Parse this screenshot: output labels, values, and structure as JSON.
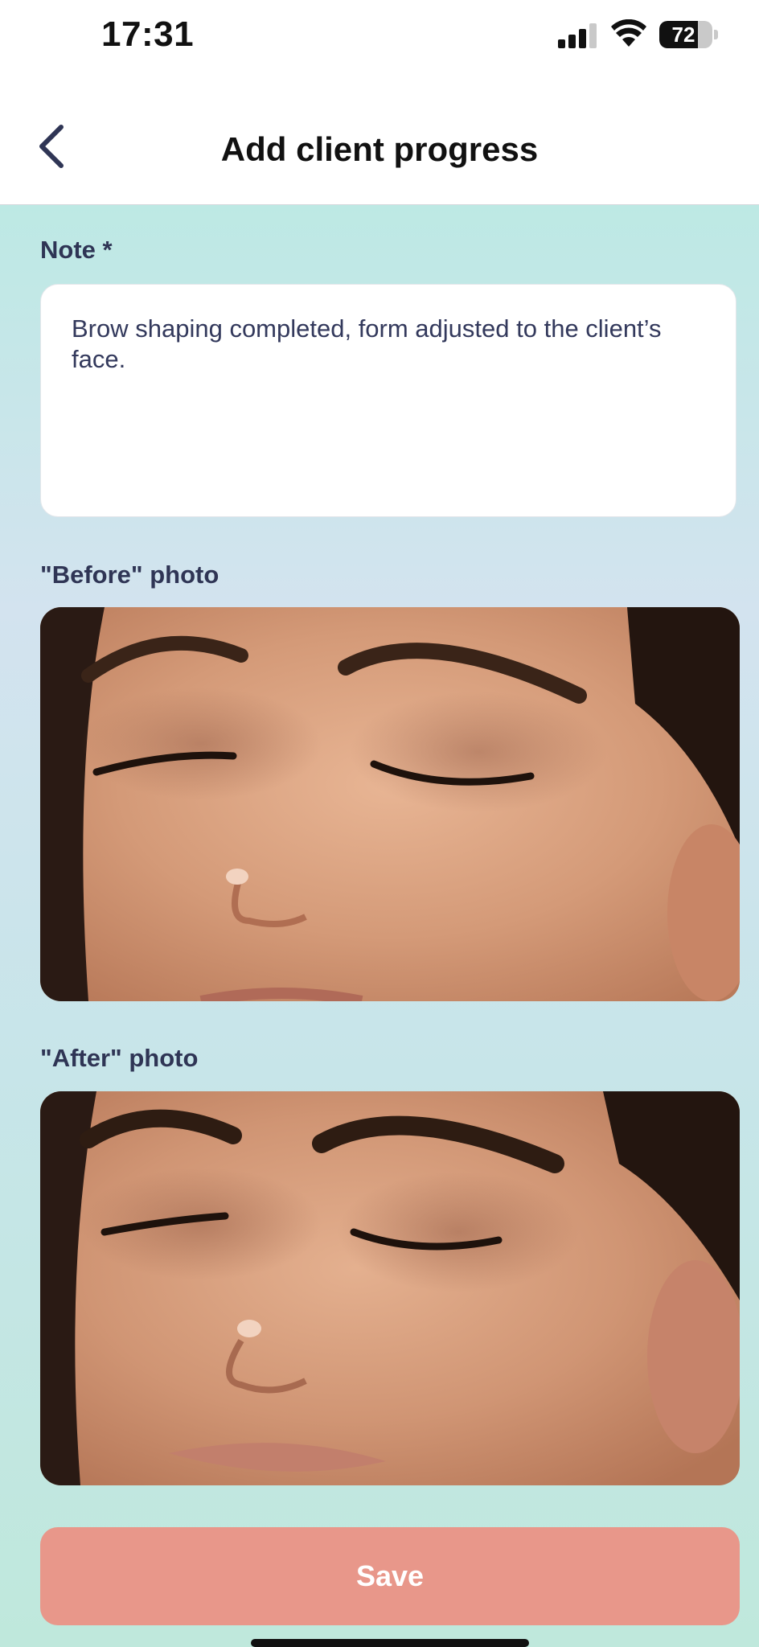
{
  "status_bar": {
    "time": "17:31",
    "battery_level": "72",
    "battery_fraction": 0.72
  },
  "header": {
    "title": "Add client progress",
    "back_icon": "chevron-left-icon"
  },
  "note": {
    "label": "Note *",
    "value": "Brow shaping completed, form adjusted to the client’s face."
  },
  "before_photo": {
    "label": "\"Before\" photo"
  },
  "after_photo": {
    "label": "\"After\" photo"
  },
  "save_button": {
    "label": "Save",
    "color": "#e8978a"
  },
  "colors": {
    "label_text": "#2f3555",
    "accent": "#e8978a",
    "background_top": "#bde9e4",
    "background_bottom": "#bfe8dc"
  }
}
